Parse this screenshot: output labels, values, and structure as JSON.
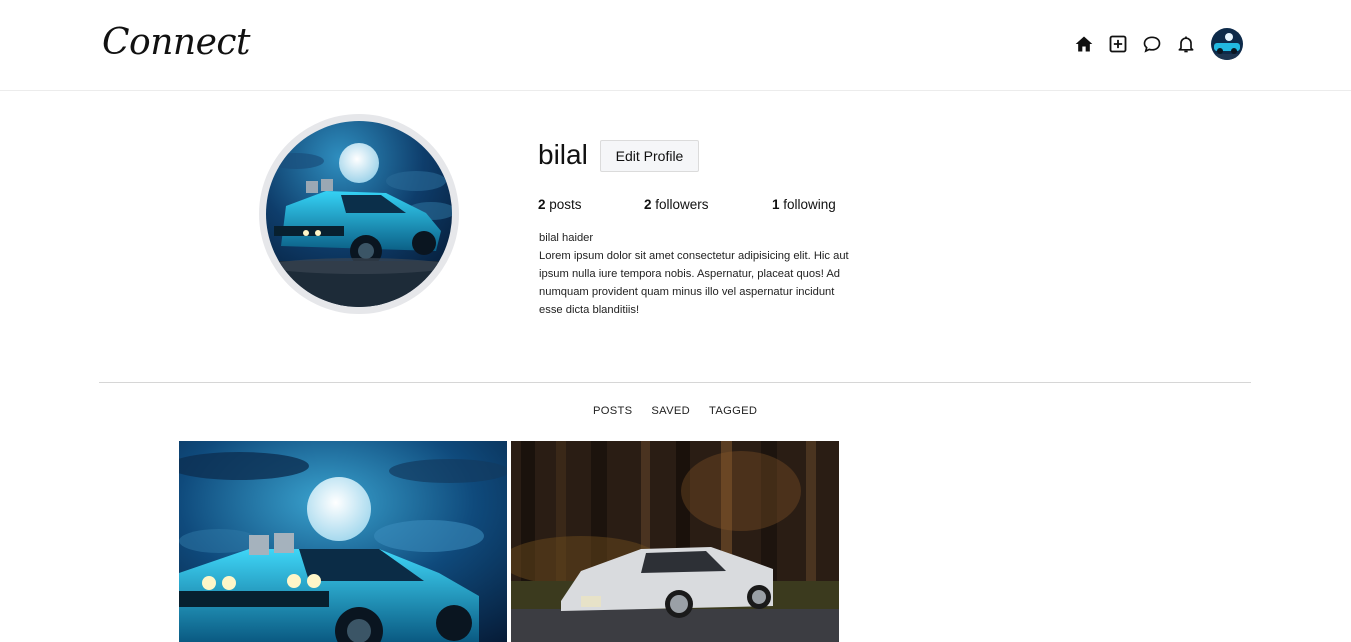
{
  "app": {
    "logo": "Connect"
  },
  "nav": {
    "icons": [
      "home-icon",
      "add-post-icon",
      "messages-icon",
      "notifications-icon"
    ],
    "avatar": "user-avatar"
  },
  "profile": {
    "username": "bilal",
    "edit_button": "Edit Profile",
    "stats": {
      "posts_count": "2",
      "posts_label": "posts",
      "followers_count": "2",
      "followers_label": "followers",
      "following_count": "1",
      "following_label": "following"
    },
    "full_name": "bilal haider",
    "bio": "Lorem ipsum dolor sit amet consectetur adipisicing elit. Hic aut ipsum nulla iure tempora nobis. Aspernatur, placeat quos! Ad numquam provident quam minus illo vel aspernatur incidunt esse dicta blanditiis!"
  },
  "tabs": [
    "POSTS",
    "SAVED",
    "TAGGED"
  ],
  "posts": [
    {
      "image": "muscle-car-moonlight-photo"
    },
    {
      "image": "white-sports-car-forest-photo"
    }
  ],
  "colors": {
    "accent": "#111111",
    "border": "#dbdbdb",
    "ring": "#e6e7ea"
  }
}
